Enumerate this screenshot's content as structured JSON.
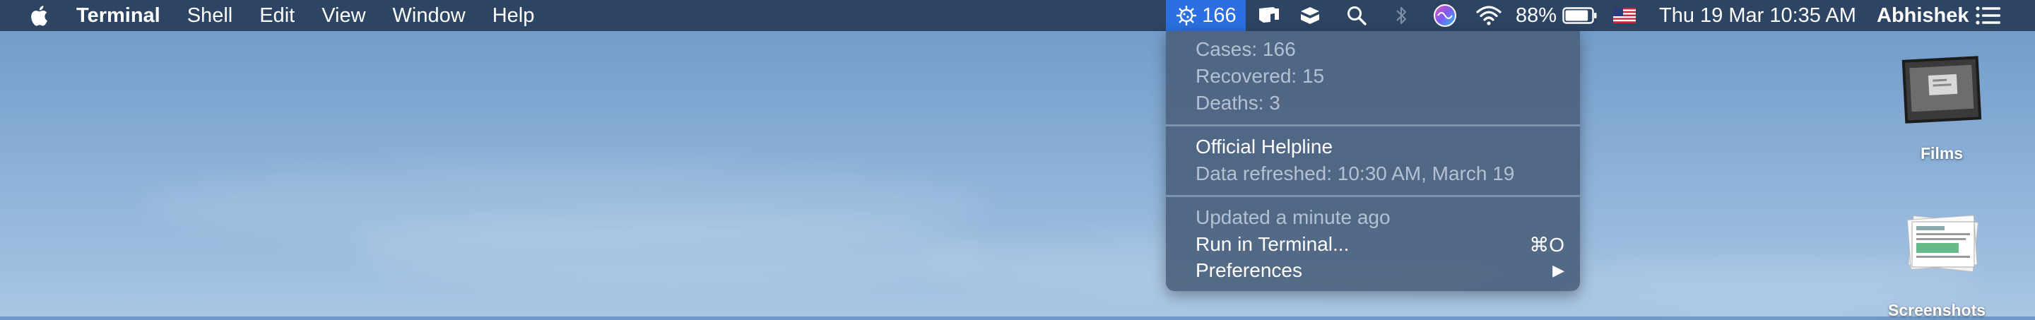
{
  "menubar": {
    "apple_icon": "apple-logo-icon",
    "app_name": "Terminal",
    "menus": [
      "Shell",
      "Edit",
      "View",
      "Window",
      "Help"
    ],
    "covid": {
      "count": "166",
      "icon": "virus-icon",
      "highlight_color": "#2b6fe0"
    },
    "status_icons": [
      "notification-icon",
      "inbox-icon",
      "search-icon",
      "bluetooth-icon",
      "siri-icon",
      "wifi-icon"
    ],
    "battery": {
      "percent_label": "88%",
      "level": 0.88
    },
    "input_source": "us-flag-icon",
    "datetime": "Thu 19 Mar  10:35 AM",
    "user": "Abhishek",
    "notification_center_icon": "list-icon"
  },
  "dropdown": {
    "stats": [
      "Cases: 166",
      "Recovered: 15",
      "Deaths: 3"
    ],
    "helpline": "Official Helpline",
    "refreshed": "Data refreshed:  10:30 AM, March 19",
    "updated": "Updated a minute ago",
    "run": {
      "label": "Run in Terminal...",
      "shortcut": "⌘O"
    },
    "preferences": {
      "label": "Preferences",
      "submenu_arrow": "▶"
    }
  },
  "desktop": {
    "icons": [
      {
        "label": "Films",
        "icon": "folder-thumbnail-icon"
      },
      {
        "label": "Screenshots",
        "icon": "folder-stack-icon"
      }
    ]
  },
  "colors": {
    "menubar_bg": "#2d4462",
    "dropdown_bg": "#4a607c",
    "accent": "#2b6fe0"
  }
}
